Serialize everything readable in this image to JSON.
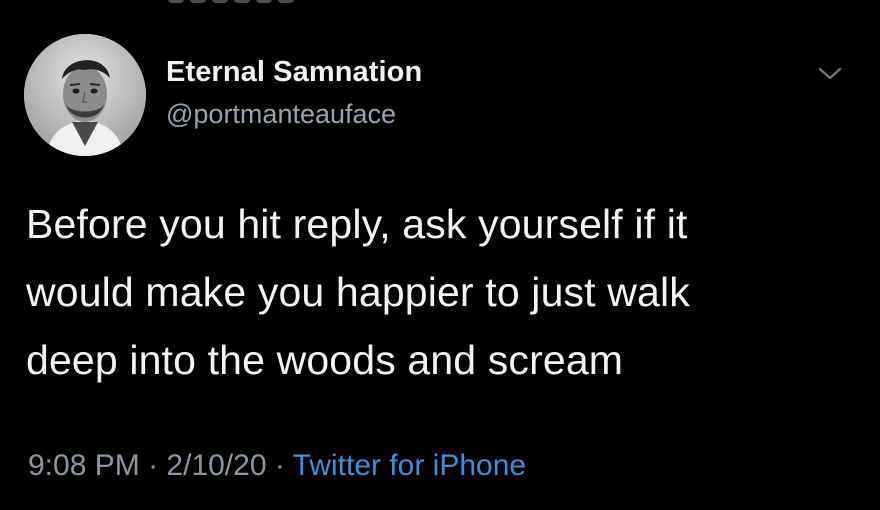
{
  "author": {
    "display_name": "Eternal Samnation",
    "handle": "@portmanteauface",
    "avatar_alt": "avatar"
  },
  "tweet": {
    "lines": [
      "Before you hit reply, ask yourself if it",
      "would make you happier to just walk",
      "deep into the woods and scream"
    ]
  },
  "meta": {
    "time": "9:08 PM",
    "separator": "·",
    "date": "2/10/20",
    "source": "Twitter for iPhone"
  },
  "icons": {
    "menu": "chevron-down-icon"
  },
  "colors": {
    "background": "#000000",
    "text": "#f4f4f4",
    "muted": "#8e959c",
    "link": "#3e8fd6"
  }
}
